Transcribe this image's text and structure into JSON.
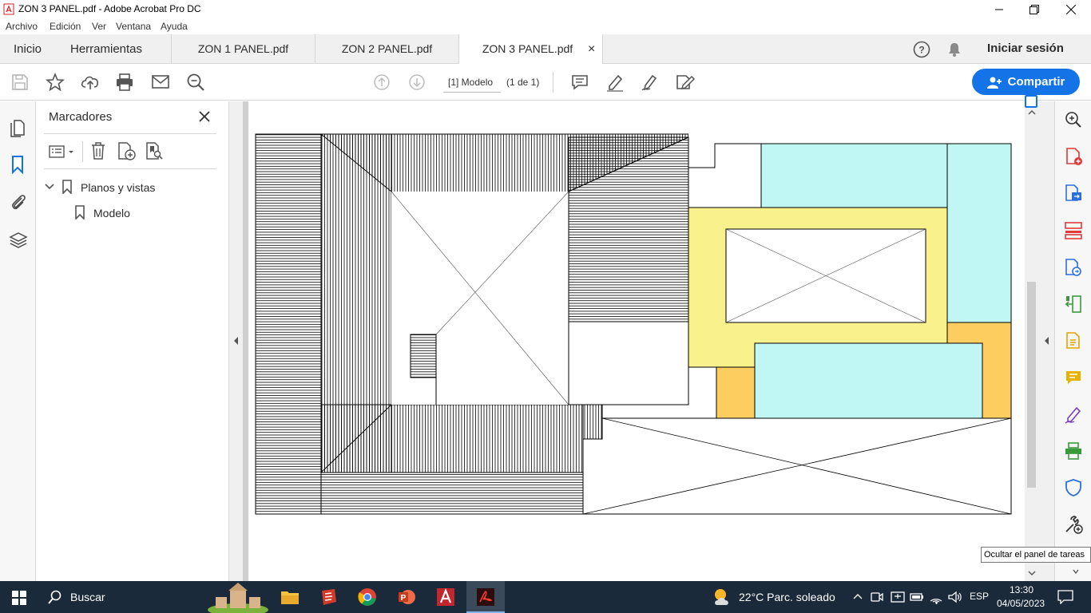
{
  "window": {
    "title": "ZON 3 PANEL.pdf - Adobe Acrobat Pro DC"
  },
  "menu": [
    "Archivo",
    "Edición",
    "Ver",
    "Ventana",
    "Ayuda"
  ],
  "nav_tabs": {
    "home": "Inicio",
    "tools": "Herramientas"
  },
  "doc_tabs": [
    {
      "label": "ZON 1 PANEL.pdf"
    },
    {
      "label": "ZON 2 PANEL.pdf"
    },
    {
      "label": "ZON 3 PANEL.pdf",
      "close": "×"
    }
  ],
  "header_right": {
    "signin": "Iniciar sesión"
  },
  "toolbar": {
    "page_label": "[1] Modelo",
    "page_count": "(1 de 1)",
    "share_label": "Compartir"
  },
  "bookmarks": {
    "title": "Marcadores",
    "items": [
      {
        "label": "Planos y vistas"
      },
      {
        "label": "Modelo"
      }
    ]
  },
  "tooltip": "Ocultar el panel de tareas",
  "taskbar": {
    "search": "Buscar",
    "weather": "22°C  Parc. soleado",
    "lang": "ESP",
    "time": "13:30",
    "date": "04/05/2023"
  },
  "colors": {
    "accent": "#1473e6",
    "cyan_zone": "#c0f7f4",
    "yellow_zone": "#f9f18b",
    "orange_zone": "#fdcd5f",
    "right_tool_icons": "#e03a3a"
  }
}
